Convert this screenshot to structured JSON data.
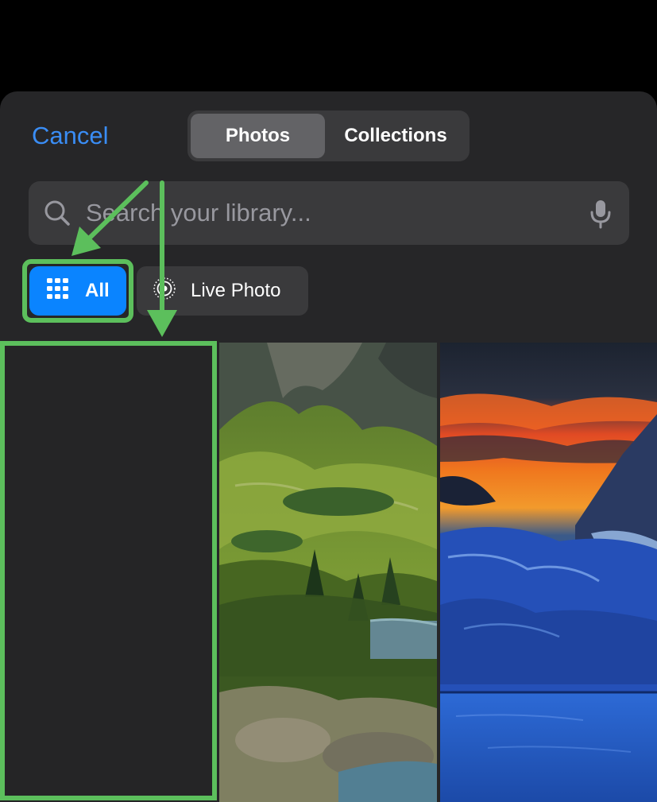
{
  "header": {
    "cancel_label": "Cancel",
    "segments": [
      {
        "label": "Photos",
        "selected": true
      },
      {
        "label": "Collections",
        "selected": false
      }
    ]
  },
  "search": {
    "placeholder": "Search your library...",
    "icon": "search-icon",
    "mic_icon": "microphone-icon"
  },
  "filters": [
    {
      "label": "All",
      "icon": "grid-icon",
      "selected": true
    },
    {
      "label": "Live Photo",
      "icon": "live-photo-icon",
      "selected": false
    }
  ],
  "photos": [
    {
      "kind": "empty"
    },
    {
      "kind": "mountain-lake-landscape"
    },
    {
      "kind": "sunset-mountain-lake"
    }
  ],
  "annotations": {
    "color": "#5CBF5C",
    "note": "green highlight boxes and arrows"
  },
  "colors": {
    "accent": "#0A84FF",
    "link": "#3A8DF5",
    "sheet_bg": "#262628"
  }
}
